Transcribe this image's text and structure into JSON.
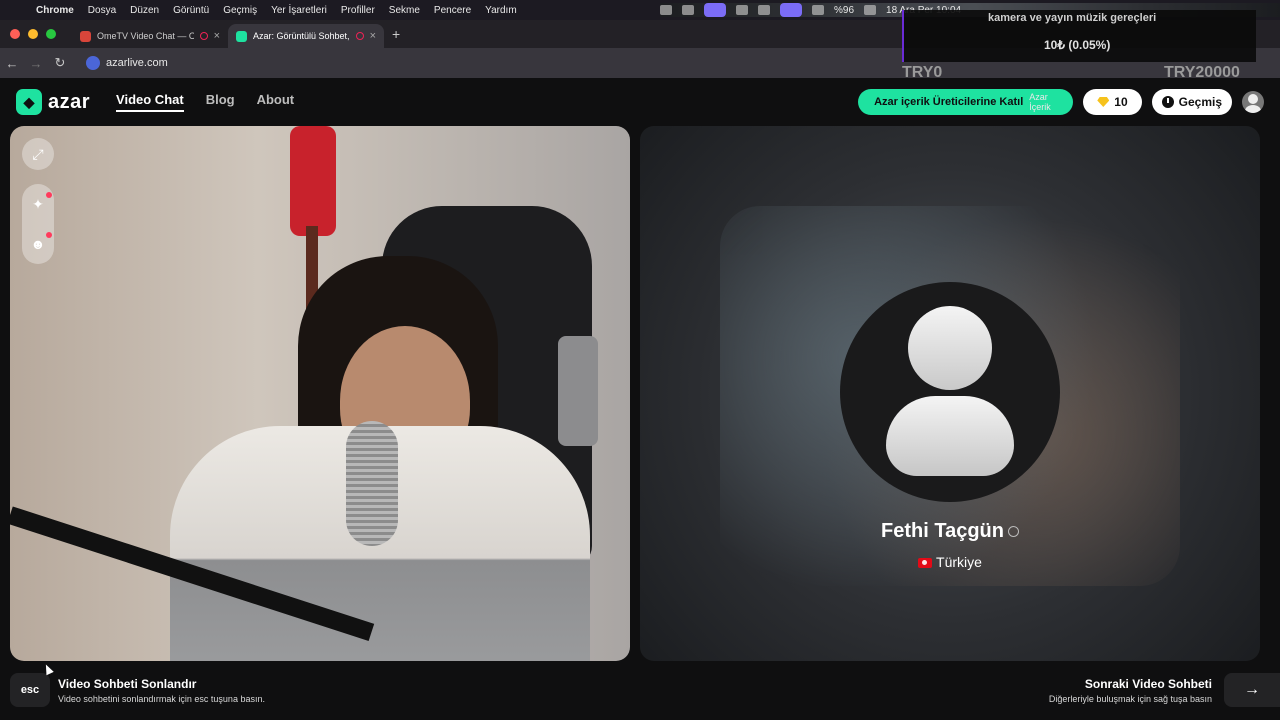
{
  "macos": {
    "apple_icon": "apple-icon",
    "menu": [
      "Chrome",
      "Dosya",
      "Düzen",
      "Görüntü",
      "Geçmiş",
      "Yer İşaretleri",
      "Profiller",
      "Sekme",
      "Pencere",
      "Yardım"
    ],
    "battery": "%96",
    "datetime": "18 Ara Per  10:04"
  },
  "browser": {
    "tabs": [
      {
        "title": "OmeTV Video Chat — Om",
        "recording": true
      },
      {
        "title": "Azar: Görüntülü Sohbet, ",
        "recording": true
      }
    ],
    "new_tab": "+",
    "url": "azarlive.com"
  },
  "stream_overlay": {
    "title": "kamera ve yayın müzik gereçleri",
    "progress": "10₺ (0.05%)",
    "left_tag": "TRY0",
    "right_tag": "TRY20000"
  },
  "site": {
    "logo": "azar",
    "nav": [
      "Video Chat",
      "Blog",
      "About"
    ],
    "creator_button": "Azar içerik Üreticilerine Katıl",
    "creator_img_alt": "Azar İçerik",
    "gems": "10",
    "history_button": "Geçmiş"
  },
  "partner": {
    "name": "Fethi Taçgün",
    "country": "Türkiye"
  },
  "footer": {
    "esc_key": "esc",
    "end_title": "Video Sohbeti Sonlandır",
    "end_subtitle": "Video sohbetini sonlandırmak için esc tuşuna basın.",
    "next_title": "Sonraki Video Sohbeti",
    "next_subtitle": "Diğerleriyle buluşmak için sağ tuşa basın",
    "next_key": "→"
  },
  "colors": {
    "accent": "#1ee2a0",
    "badge_dot": "#ff3a5c",
    "gem": "#f6c21c"
  }
}
